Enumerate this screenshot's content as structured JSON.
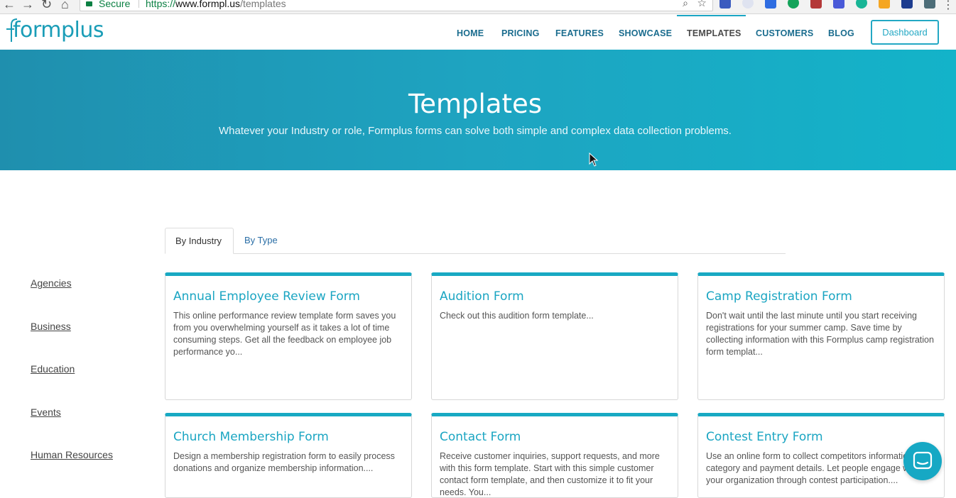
{
  "browser": {
    "secure_label": "Secure",
    "url_scheme": "https://",
    "url_host": "www.formpl.us",
    "url_path": "/templates"
  },
  "header": {
    "logo_text": "formplus",
    "nav": [
      "HOME",
      "PRICING",
      "FEATURES",
      "SHOWCASE",
      "TEMPLATES",
      "CUSTOMERS",
      "BLOG"
    ],
    "active_nav": "TEMPLATES",
    "dashboard_button": "Dashboard"
  },
  "hero": {
    "title": "Templates",
    "subtitle": "Whatever your Industry or role, Formplus forms can solve both simple and complex data collection problems."
  },
  "tabs": {
    "by_industry": "By Industry",
    "by_type": "By Type",
    "active": "By Industry"
  },
  "sidebar": {
    "items": [
      "Agencies",
      "Business",
      "Education",
      "Events",
      "Human Resources"
    ]
  },
  "cards": [
    {
      "title": "Annual Employee Review Form",
      "desc": "This online performance review template form saves you from you overwhelming yourself as it takes a lot of time consuming steps. Get all the feedback on employee job performance yo..."
    },
    {
      "title": "Audition Form",
      "desc": "Check out this audition form template..."
    },
    {
      "title": "Camp Registration Form",
      "desc": "Don't wait until the last minute until you start receiving registrations for your summer camp. Save time by collecting information with this Formplus camp registration form templat..."
    },
    {
      "title": "Church Membership Form",
      "desc": "Design a membership registration form to easily process donations and organize membership information...."
    },
    {
      "title": "Contact Form",
      "desc": "Receive customer inquiries, support requests, and more with this form template. Start with this simple customer contact form template, and then customize it to fit your needs. You..."
    },
    {
      "title": "Contest Entry Form",
      "desc": "Use an online form to collect competitors information, category and payment details. Let people engage with your organization through contest participation...."
    }
  ],
  "colors": {
    "brand": "#1aa5c2",
    "nav_text": "#1a6c8e",
    "hero_start": "#1f8fae",
    "hero_end": "#13b3c9"
  }
}
